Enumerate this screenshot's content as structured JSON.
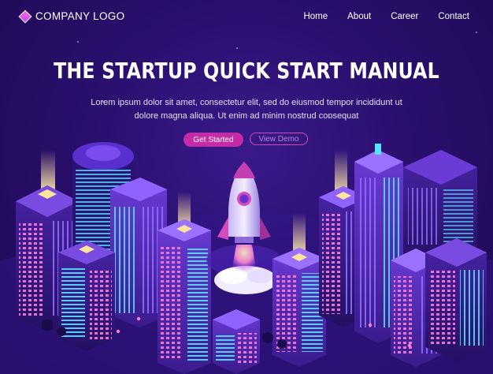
{
  "header": {
    "logo_text": "COMPANY LOGO",
    "nav": [
      "Home",
      "About",
      "Career",
      "Contact"
    ]
  },
  "hero": {
    "title": "THE STARTUP QUICK START MANUAL",
    "description_line1": "Lorem ipsum dolor sit amet, consectetur elit, sed do eiusmod tempor incididunt ut",
    "description_line2": "dolore magna aliqua. Ut enim ad minim nostrud consequat",
    "primary_button": "Get Started",
    "secondary_button": "View Demo"
  },
  "colors": {
    "background": "#2a0f6e",
    "accent_pink": "#c42ba7",
    "neon_cyan": "#56e3ff",
    "neon_purple": "#8a5cff"
  },
  "icons": [
    "diamond-logo-icon",
    "rocket-illustration"
  ]
}
